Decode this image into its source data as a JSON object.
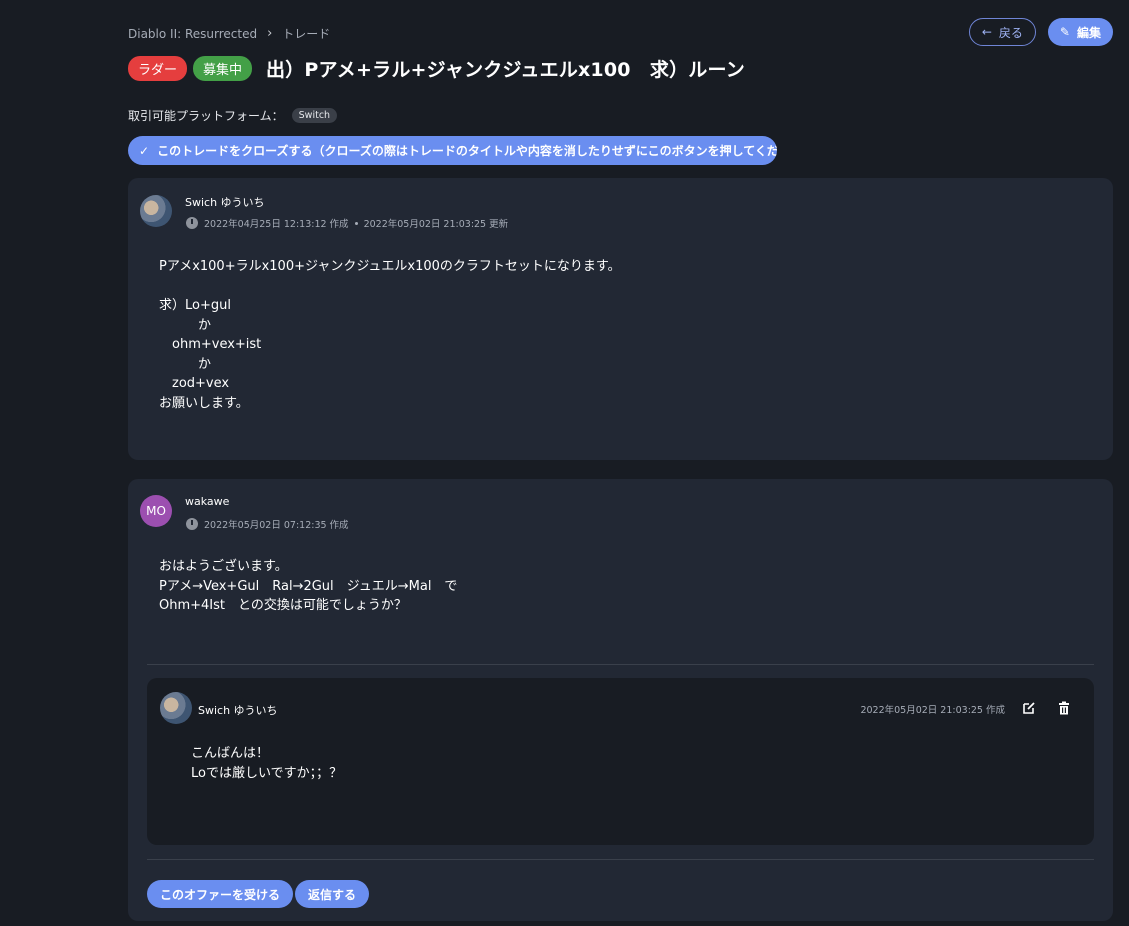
{
  "breadcrumb": [
    "Diablo II: Resurrected",
    "トレード"
  ],
  "header": {
    "back_label": "戻る",
    "edit_label": "編集",
    "chips": [
      "ラダー",
      "募集中"
    ],
    "title": "出）Pアメ+ラル+ジャンクジュエルx100　求）ルーン",
    "platform_label": "取引可能プラットフォーム：",
    "platform_chip": "Switch",
    "close_button": "このトレードをクローズする（クローズの際はトレードのタイトルや内容を消したりせずにこのボタンを押してください）"
  },
  "post": {
    "author": "Swich ゆういち",
    "created": "2022年04月25日 12:13:12 作成",
    "updated": "2022年05月02日 21:03:25 更新",
    "body": "Pアメx100+ラルx100+ジャンクジュエルx100のクラフトセットになります。\n\n求）Lo+gul\n　　　か\n　ohm+vex+ist\n　　　か\n　zod+vex\nお願いします。"
  },
  "offer": {
    "avatar_text": "MO",
    "author": "wakawe",
    "created": "2022年05月02日 07:12:35 作成",
    "body": "おはようございます。\nPアメ→Vex+Gul　Ral→2Gul　ジュエル→Mal　で\nOhm+4Ist　との交換は可能でしょうか？",
    "reply": {
      "author": "Swich ゆういち",
      "created": "2022年05月02日 21:03:25 作成",
      "body": "こんばんは！\nLoでは厳しいですか；；？"
    },
    "accept_label": "このオファーを受ける",
    "reply_label": "返信する"
  }
}
